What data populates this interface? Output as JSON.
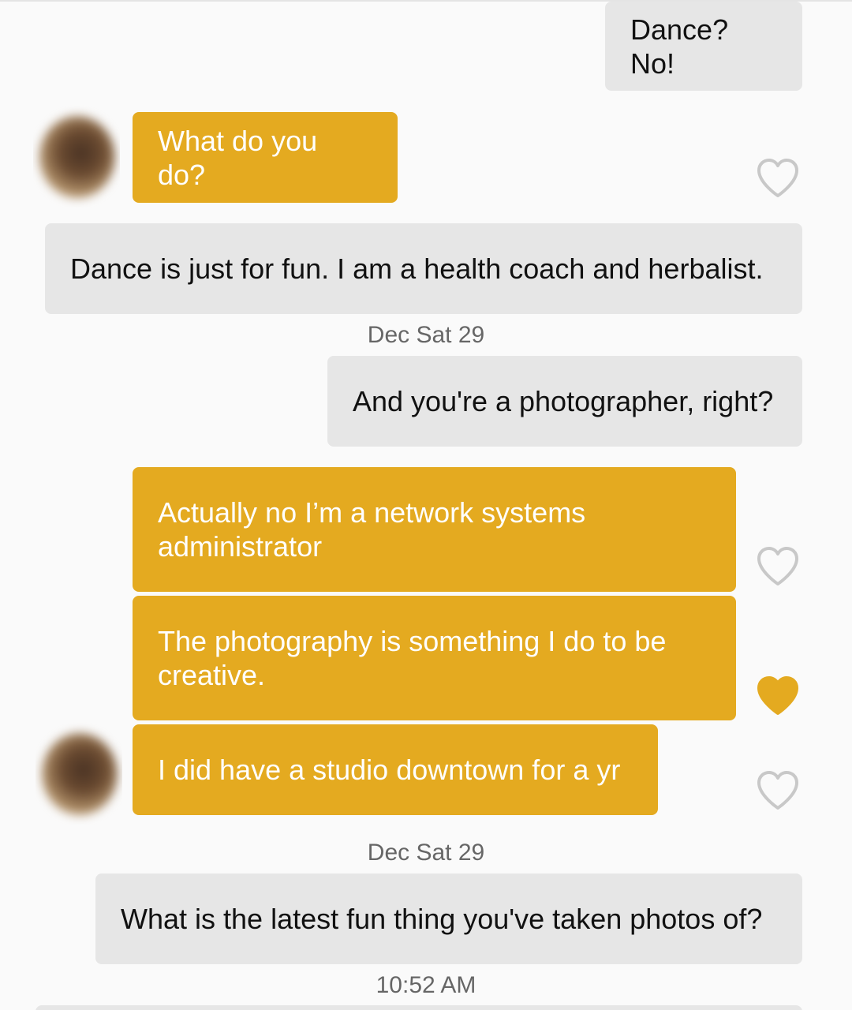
{
  "messages": {
    "m1": "Dance? No!",
    "m2": "What do you do?",
    "m3": "Dance is just for fun. I am a health coach and herbalist.",
    "m4": "And you're a photographer, right?",
    "m5": "Actually no I’m a network systems administrator",
    "m6": "The photography is something I do to be creative.",
    "m7": "I did have a studio downtown for a yr",
    "m8": "What is the latest fun thing you've taken photos of?"
  },
  "timestamps": {
    "t1": "Dec Sat 29",
    "t2": "Dec Sat 29",
    "t3": "10:52 AM"
  },
  "likes": {
    "m2": "heart-outline",
    "m5": "heart-outline",
    "m6": "heart-filled",
    "m7": "heart-outline"
  },
  "colors": {
    "incoming_bubble": "#e4aa20",
    "outgoing_bubble": "#e6e6e6",
    "heart_outline": "#c8c8c8",
    "heart_filled": "#e4aa20"
  }
}
